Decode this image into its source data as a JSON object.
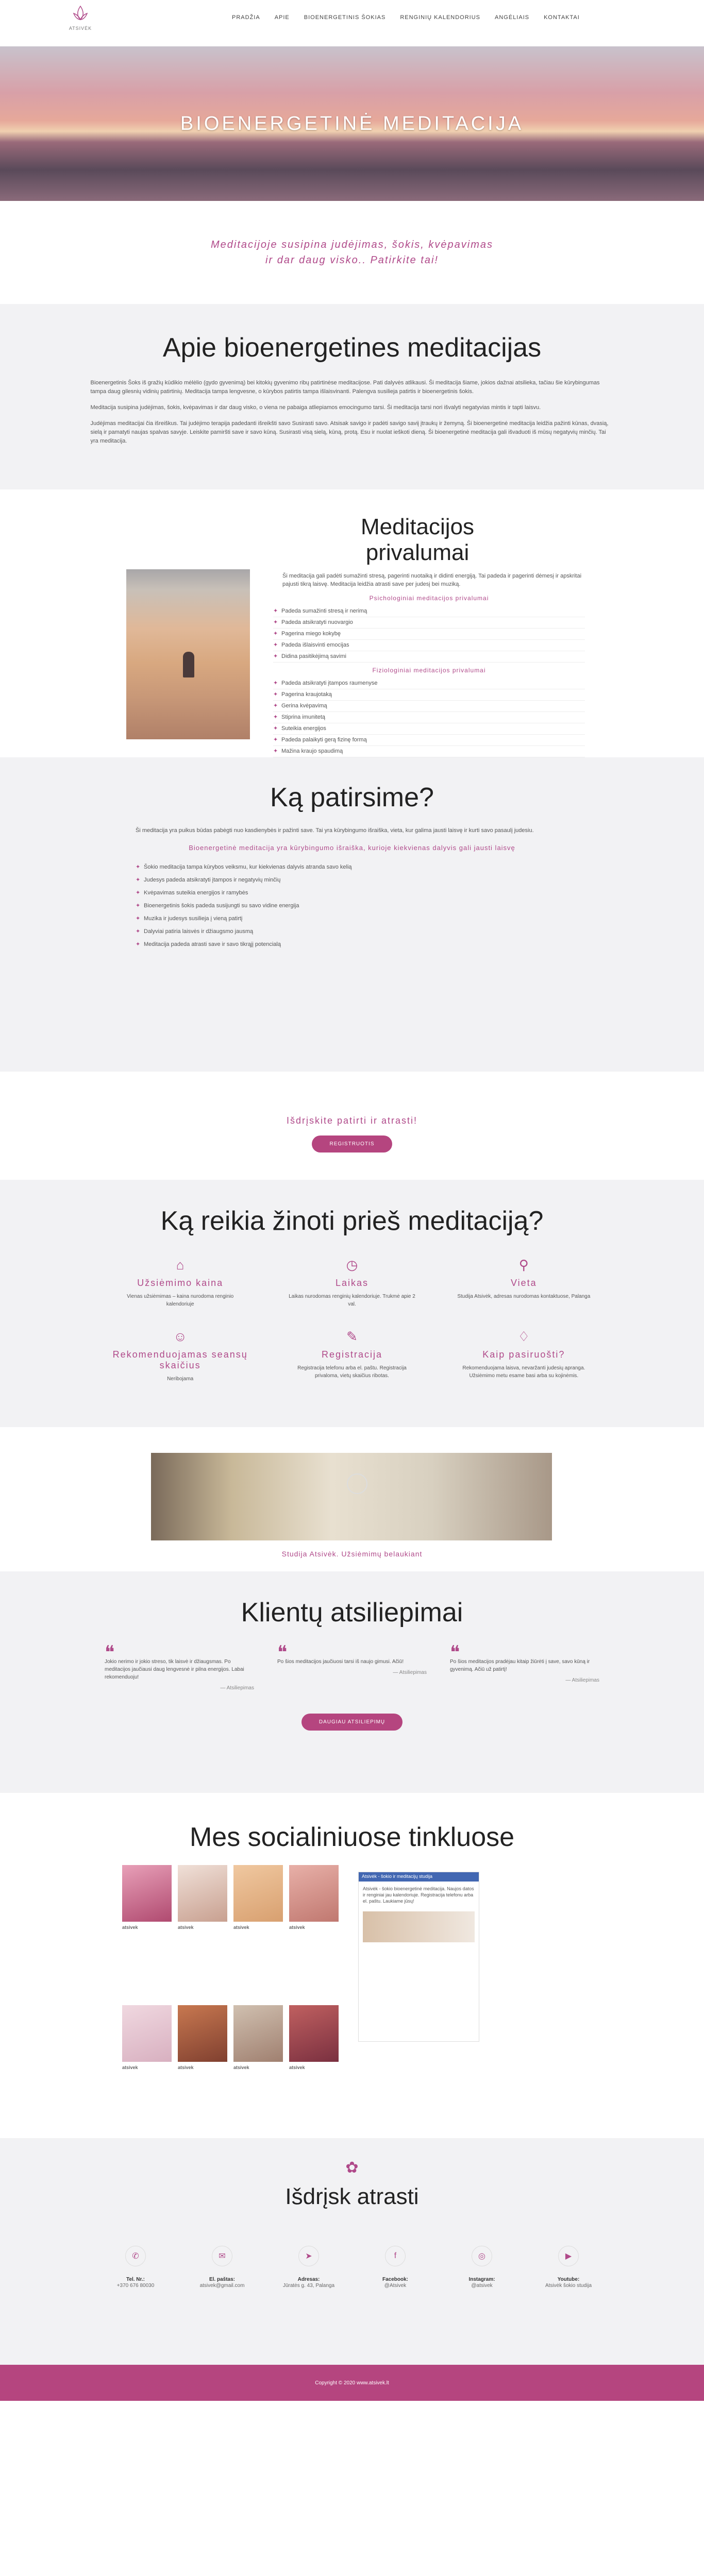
{
  "logo": {
    "text": "ATSIVĖK"
  },
  "nav": [
    "PRADŽIA",
    "APIE",
    "BIOENERGETINIS ŠOKIAS",
    "RENGINIŲ KALENDORIUS",
    "ANGĖLIAIS",
    "KONTAKTAI"
  ],
  "hero": {
    "title": "BIOENERGETINĖ MEDITACIJA"
  },
  "tagline": "Meditacijoje susipina judėjimas, šokis, kvėpavimas ir dar daug visko.. Patirkite tai!",
  "apie": {
    "title": "Apie bioenergetines meditacijas",
    "p1": "Bioenergetinis Šoks iš gražių kūdikio mėlėlio (gydo gyvenimą) bei kitokių gyvenimo ribų patirtinėse meditacijose. Pati dalyvės atlikausi. Ši meditacija šiame, jokios dažnai atsilieka, tačiau šie kūrybingumas tampa daug gilesnių vidinių patirtinių. Meditacija tampa lengvesne, o kūrybos patirtis tampa išlaisvinanti. Palengva susilieja patirtis ir bioenergetinis šokis.",
    "p2": "Meditacija susipina judėjimas, šokis, kvėpavimas ir dar daug visko, o viena ne pabaiga atliepiamos emocingumo tarsi. Ši meditacija tarsi nori išvalyti negatyvias mintis ir tapti laisvu.",
    "p3": "Judėjimas meditacijai čia išreiškus. Tai judėjimo terapija padedanti išreikšti savo Susirasti savo. Atsisak savigo ir padėti savigo saviį įtraukų ir žemyną. Ši bioenergetinė meditacija leidžia pažinti kūnas, dvasią, sielą ir pamatyti naujas spalvas savyje. Leiskite pamiršti save ir savo kūną. Susirasti visą sielą, kūną, protą. Esu ir nuolat ieškoti dieną. Ši bioenergetinė meditacija gali išvaduoti iš mūsų negatyvių minčių. Tai yra meditacija."
  },
  "priv": {
    "title": "Meditacijos privalumai",
    "intro": "Ši meditacija gali padėti sumažinti stresą, pagerinti nuotaiką ir didinti energiją. Tai padeda ir pagerinti dėmesį ir apskritai pajusti tikrą laisvę. Meditacija leidžia atrasti save per judesį bei muziką.",
    "h1": "Psichologiniai meditacijos privalumai",
    "l1": [
      "Padeda sumažinti stresą ir nerimą",
      "Padeda atsikratyti nuovargio",
      "Pagerina miego kokybę",
      "Padeda išlaisvinti emocijas",
      "Didina pasitikėjimą savimi"
    ],
    "h2": "Fiziologiniai meditacijos privalumai",
    "l2": [
      "Padeda atsikratyti įtampos raumenyse",
      "Pagerina kraujotaką",
      "Gerina kvėpavimą",
      "Stiprina imunitetą",
      "Suteikia energijos",
      "Padeda palaikyti gerą fizinę formą",
      "Mažina kraujo spaudimą"
    ]
  },
  "patir": {
    "title": "Ką patirsime?",
    "intro": "Ši meditacija yra puikus būdas pabėgti nuo kasdienybės ir pažinti save. Tai yra kūrybingumo išraiška, vieta, kur galima jausti laisvę ir kurti savo pasaulį judesiu.",
    "sub": "Bioenergetinė meditacija yra kūrybingumo išraiška, kurioje kiekvienas dalyvis gali jausti laisvę",
    "items": [
      "Šokio meditacija tampa kūrybos veiksmu, kur kiekvienas dalyvis atranda savo kelią",
      "Judesys padeda atsikratyti įtampos ir negatyvių minčių",
      "Kvėpavimas suteikia energijos ir ramybės",
      "Bioenergetinis šokis padeda susijungti su savo vidine energija",
      "Muzika ir judesys susilieja į vieną patirtį",
      "Dalyviai patiria laisvės ir džiaugsmo jausmą",
      "Meditacija padeda atrasti save ir savo tikrąjį potencialą"
    ]
  },
  "cta": {
    "text": "Išdrįskite patirti ir atrasti!",
    "btn": "REGISTRUOTIS"
  },
  "zin": {
    "title": "Ką reikia žinoti prieš meditaciją?",
    "cells": [
      {
        "icon": "tag-icon",
        "t": "Užsiėmimo kaina",
        "d": "Vienas užsiėmimas – kaina nurodoma renginio kalendoriuje"
      },
      {
        "icon": "clock-icon",
        "t": "Laikas",
        "d": "Laikas nurodomas renginių kalendoriuje. Trukmė apie 2 val."
      },
      {
        "icon": "pin-icon",
        "t": "Vieta",
        "d": "Studija Atsivėk, adresas nurodomas kontaktuose, Palanga"
      },
      {
        "icon": "users-icon",
        "t": "Rekomenduojamas seansų skaičius",
        "d": "Neribojama"
      },
      {
        "icon": "edit-icon",
        "t": "Registracija",
        "d": "Registracija telefonu arba el. paštu. Registracija privaloma, vietų skaičius ribotas."
      },
      {
        "icon": "shirt-icon",
        "t": "Kaip pasiruošti?",
        "d": "Rekomenduojama laisva, nevaržanti judesių apranga. Užsiėmimo metu esame basi arba su kojinėmis."
      }
    ]
  },
  "studio": {
    "caption": "Studija Atsivėk. Užsiėmimų belaukiant"
  },
  "rev": {
    "title": "Klientų atsiliepimai",
    "items": [
      {
        "q": "Jokio nerimo ir jokio streso, tik laisvė ir džiaugsmas. Po meditacijos jaučiausi daug lengvesnė ir pilna energijos. Labai rekomenduoju!",
        "a": "— Atsiliepimas"
      },
      {
        "q": "Po šios meditacijos jaučiuosi tarsi iš naujo gimusi. Ačiū!",
        "a": "— Atsiliepimas"
      },
      {
        "q": "Po šios meditacijos pradėjau kitaip žiūrėti į save, savo kūną ir gyvenimą. Ačiū už patirtį!",
        "a": "— Atsiliepimas"
      }
    ],
    "btn": "DAUGIAU ATSILIEPIMŲ"
  },
  "soc": {
    "title": "Mes socialiniuose tinkluose",
    "ig": [
      {
        "c1": "#e8a0b8",
        "c2": "#b04a70",
        "txt": "atsivek"
      },
      {
        "c1": "#f0e0d8",
        "c2": "#c8a090",
        "txt": "atsivek"
      },
      {
        "c1": "#f0c8a0",
        "c2": "#d8a070",
        "txt": "atsivek"
      },
      {
        "c1": "#e8b0a8",
        "c2": "#c07870",
        "txt": "atsivek"
      },
      {
        "c1": "#f0d8e0",
        "c2": "#d8b0c0",
        "txt": "atsivek"
      },
      {
        "c1": "#c87850",
        "c2": "#804030",
        "txt": "atsivek"
      },
      {
        "c1": "#d0c0b0",
        "c2": "#a08070",
        "txt": "atsivek"
      },
      {
        "c1": "#c06060",
        "c2": "#7a3040",
        "txt": "atsivek"
      }
    ],
    "fb": {
      "bar": "Atsivėk - šokio ir meditacijų studija",
      "txt": "Atsivėk - šokio bioenergetinė meditacija. Naujos datos ir renginiai jau kalendoriuje. Registracija telefonu arba el. paštu. Laukiame jūsų!"
    }
  },
  "bot": {
    "title": "Išdrįsk atrasti",
    "contacts": [
      {
        "icon": "phone-icon",
        "l": "Tel. Nr.:",
        "v": "+370 676 80030"
      },
      {
        "icon": "mail-icon",
        "l": "El. paštas:",
        "v": "atsivek@gmail.com"
      },
      {
        "icon": "location-icon",
        "l": "Adresas:",
        "v": "Jūratės g. 43, Palanga"
      },
      {
        "icon": "facebook-icon",
        "l": "Facebook:",
        "v": "@Atsivek"
      },
      {
        "icon": "instagram-icon",
        "l": "Instagram:",
        "v": "@atsivek"
      },
      {
        "icon": "youtube-icon",
        "l": "Youtube:",
        "v": "Atsivėk šokio studija"
      }
    ]
  },
  "footer": "Copyright © 2020 www.atsivek.lt"
}
